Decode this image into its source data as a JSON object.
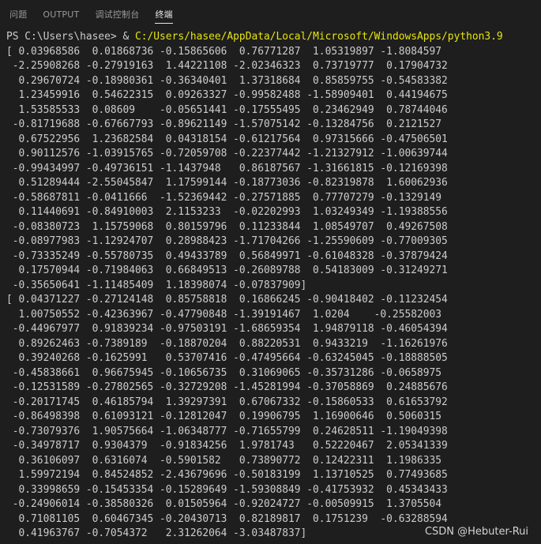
{
  "panel": {
    "tabs": [
      {
        "label": "问题"
      },
      {
        "label": "OUTPUT"
      },
      {
        "label": "调试控制台"
      },
      {
        "label": "终端"
      }
    ],
    "active_tab": "终端"
  },
  "terminal": {
    "prompt": {
      "ps": "PS C:\\Users\\hasee> ",
      "amp": "& ",
      "path": "C:/Users/hasee/AppData/Local/Microsoft/WindowsApps/python3.9"
    },
    "lines": [
      "[ 0.03968586  0.01868736 -0.15865606  0.76771287  1.05319897 -1.8084597",
      " -2.25908268 -0.27919163  1.44221108 -2.02346323  0.73719777  0.17904732",
      "  0.29670724 -0.18980361 -0.36340401  1.37318684  0.85859755 -0.54583382",
      "  1.23459916  0.54622315  0.09263327 -0.99582488 -1.58909401  0.44194675",
      "  1.53585533  0.08609    -0.05651441 -0.17555495  0.23462949  0.78744046",
      " -0.81719688 -0.67667793 -0.89621149 -1.57075142 -0.13284756  0.2121527",
      "  0.67522956  1.23682584  0.04318154 -0.61217564  0.97315666 -0.47506501",
      "  0.90112576 -1.03915765 -0.72059708 -0.22377442 -1.21327912 -1.00639744",
      " -0.99434997 -0.49736151 -1.1437948   0.86187567 -1.31661815 -0.12169398",
      "  0.51289444 -2.55045847  1.17599144 -0.18773036 -0.82319878  1.60062936",
      " -0.58687811 -0.0411666  -1.52369442 -0.27571885  0.77707279 -0.1329149",
      "  0.11440691 -0.84910003  2.1153233  -0.02202993  1.03249349 -1.19388556",
      " -0.08380723  1.15759068  0.80159796  0.11233844  1.08549707  0.49267508",
      " -0.08977983 -1.12924707  0.28988423 -1.71704266 -1.25590609 -0.77009305",
      " -0.73335249 -0.55780735  0.49433789  0.56849971 -0.61048328 -0.37879424",
      "  0.17570944 -0.71984063  0.66849513 -0.26089788  0.54183009 -0.31249271",
      " -0.35650641 -1.11485409  1.18398074 -0.07837909]",
      "[ 0.04371227 -0.27124148  0.85758818  0.16866245 -0.90418402 -0.11232454",
      "  1.00750552 -0.42363967 -0.47790848 -1.39191467  1.0204    -0.25582003",
      " -0.44967977  0.91839234 -0.97503191 -1.68659354  1.94879118 -0.46054394",
      "  0.89262463 -0.7389189  -0.18870204  0.88220531  0.9433219  -1.16261976",
      "  0.39240268 -0.1625991   0.53707416 -0.47495664 -0.63245045 -0.18888505",
      " -0.45838661  0.96675945 -0.10656735  0.31069065 -0.35731286 -0.0658975",
      " -0.12531589 -0.27802565 -0.32729208 -1.45281994 -0.37058869  0.24885676",
      " -0.20171745  0.46185794  1.39297391  0.67067332 -0.15860533  0.61653792",
      " -0.86498398  0.61093121 -0.12812047  0.19906795  1.16900646  0.5060315",
      " -0.73079376  1.90575664 -1.06348777 -0.71655799  0.24628511 -1.19049398",
      " -0.34978717  0.9304379  -0.91834256  1.9781743   0.52220467  2.05341339",
      "  0.36106097  0.6316074  -0.5901582   0.73890772  0.12422311  1.1986335",
      "  1.59972194  0.84524852 -2.43679696 -0.50183199  1.13710525  0.77493685",
      "  0.33998659 -0.15453354 -0.15289649 -1.59308849 -0.41753932  0.45343433",
      " -0.24906014 -0.38580326  0.01505964 -0.92024727 -0.00509915  1.3705504",
      "  0.71081105  0.60467345 -0.20430713  0.82189817  0.1751239  -0.63288594",
      "  0.41963767 -0.7054372   2.31262064 -3.03487837]"
    ]
  },
  "watermark": "CSDN @Hebuter-Rui",
  "colors": {
    "background": "#1e1e1e",
    "text": "#cccccc",
    "path": "#e5e510",
    "active_tab": "#e7e7e7",
    "inactive_tab": "#9a9a9a"
  }
}
